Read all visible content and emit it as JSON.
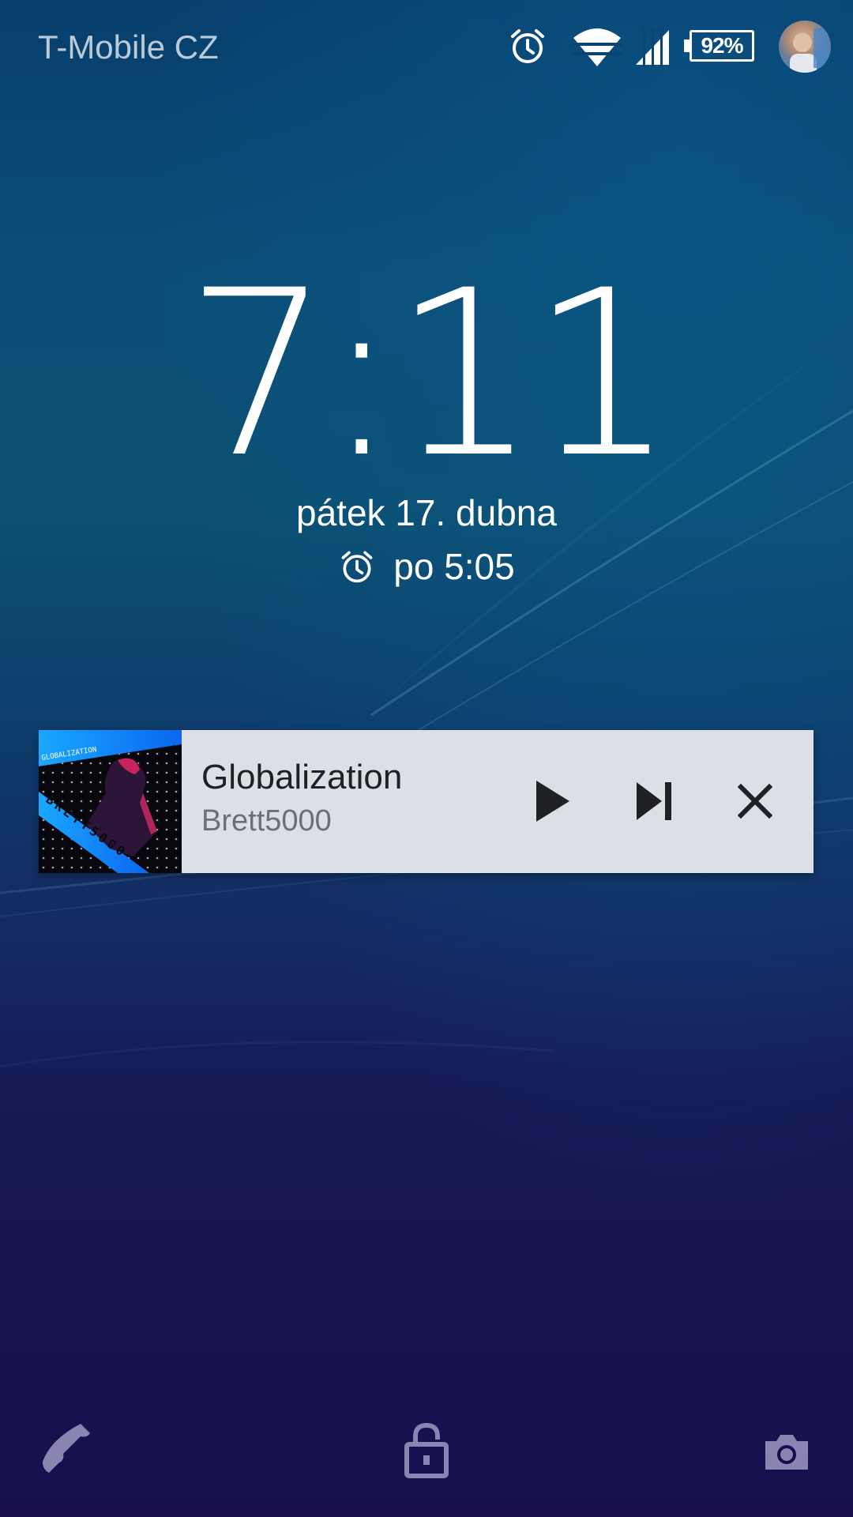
{
  "status_bar": {
    "carrier": "T-Mobile CZ",
    "battery_percent": "92%",
    "icons": [
      "alarm-icon",
      "wifi-icon",
      "cell-signal-icon",
      "battery-icon",
      "user-avatar"
    ]
  },
  "lock_screen": {
    "time": "7:11",
    "date": "pátek 17. dubna",
    "next_alarm": "po 5:05"
  },
  "media_notification": {
    "album_art_text": [
      "GLOBALIZATION",
      "BRETT5000"
    ],
    "title": "Globalization",
    "artist": "Brett5000",
    "controls": [
      "play-icon",
      "skip-next-icon",
      "close-icon"
    ]
  },
  "shortcuts": {
    "icons": [
      "phone-icon",
      "lock-icon",
      "camera-icon"
    ]
  },
  "colors": {
    "card_background": "#dcdfe6",
    "wallpaper_top": "#083e6c",
    "wallpaper_bottom": "#170f4d",
    "icon_muted": "#8a84b0"
  }
}
